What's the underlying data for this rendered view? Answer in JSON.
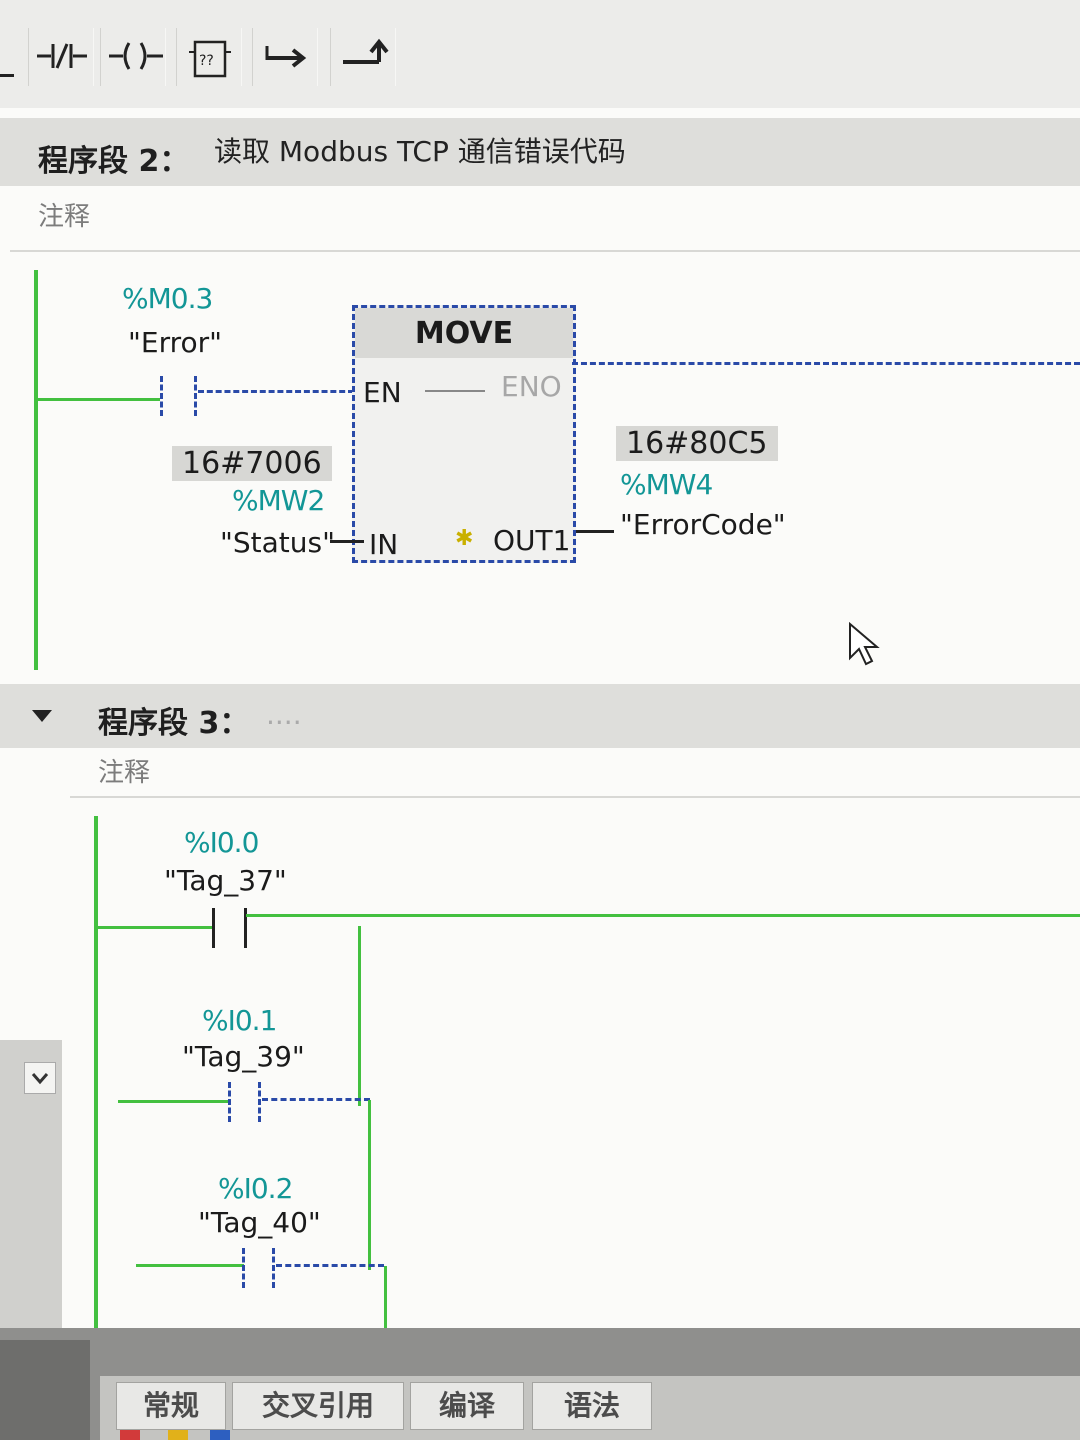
{
  "toolbar": {
    "tools": [
      {
        "name": "normally-closed-contact-icon"
      },
      {
        "name": "coil-icon"
      },
      {
        "name": "empty-box-icon",
        "label": "??"
      },
      {
        "name": "open-branch-icon"
      },
      {
        "name": "close-branch-icon"
      }
    ]
  },
  "network2": {
    "label": "程序段 2：",
    "title": "读取 Modbus TCP 通信错误代码",
    "comment": "注释",
    "contact": {
      "address": "%M0.3",
      "tag": "\"Error\""
    },
    "block": {
      "name": "MOVE",
      "en": "EN",
      "eno": "ENO",
      "in": "IN",
      "out": "OUT1",
      "star": "✱"
    },
    "input": {
      "value": "16#7006",
      "address": "%MW2",
      "tag": "\"Status\""
    },
    "output": {
      "value": "16#80C5",
      "address": "%MW4",
      "tag": "\"ErrorCode\""
    }
  },
  "network3": {
    "label": "程序段 3：",
    "title": "....",
    "comment": "注释",
    "contacts": [
      {
        "address": "%I0.0",
        "tag": "\"Tag_37\""
      },
      {
        "address": "%I0.1",
        "tag": "\"Tag_39\""
      },
      {
        "address": "%I0.2",
        "tag": "\"Tag_40\""
      }
    ]
  },
  "bottom_tabs": [
    "常规",
    "交叉引用",
    "编译",
    "语法"
  ],
  "colors": {
    "rail": "#43c040",
    "address": "#139696",
    "dashed": "#2a4aa8"
  }
}
